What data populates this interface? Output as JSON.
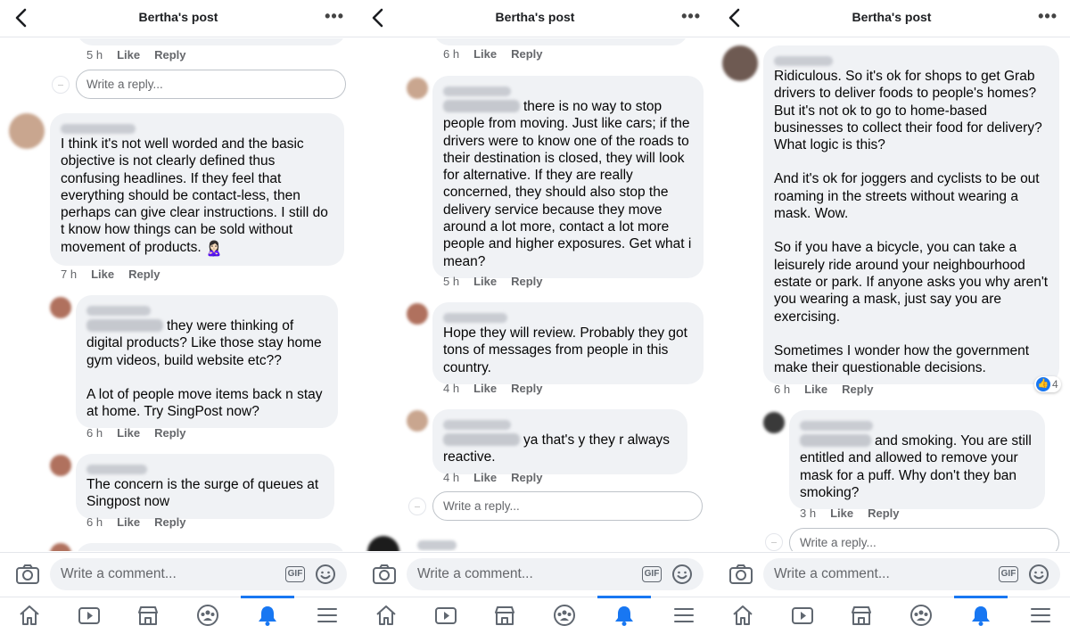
{
  "header_title": "Bertha's post",
  "more_label": "•••",
  "composer_placeholder": "Write a comment...",
  "gif_label": "GIF",
  "reply_placeholder": "Write a reply...",
  "screen1": {
    "top_meta": {
      "time": "5 h",
      "like": "Like",
      "reply": "Reply"
    },
    "c1": {
      "text": "I think it's not well worded and the basic objective is not clearly defined thus confusing headlines. If they feel that everything should be contact-less, then perhaps can give clear instructions. I still do t know how things can be sold without movement of products.",
      "emoji": "🙎🏻‍♀️",
      "time": "7 h",
      "like": "Like",
      "reply": "Reply"
    },
    "c2": {
      "line1": "they were thinking of",
      "text": "digital products? Like those stay home gym videos, build website etc??",
      "text2": "A lot of people move items back n stay at home. Try SingPost now?",
      "time": "6 h",
      "like": "Like",
      "reply": "Reply"
    },
    "c3": {
      "text": "The concern is the surge of queues at Singpost now",
      "time": "6 h",
      "like": "Like",
      "reply": "Reply"
    }
  },
  "screen2": {
    "top_meta": {
      "time": "6 h",
      "like": "Like",
      "reply": "Reply"
    },
    "c1": {
      "line1": "there is no way to stop",
      "text": "people from moving. Just like cars; if the drivers were to know one of the roads to their destination is closed, they will look for alternative. If they are really concerned, they should also stop the delivery service because they move around a lot more, contact a lot more people and higher exposures. Get what i mean?",
      "time": "5 h",
      "like": "Like",
      "reply": "Reply"
    },
    "c2": {
      "text": "Hope they will review. Probably they got tons of messages from people in this country.",
      "time": "4 h",
      "like": "Like",
      "reply": "Reply"
    },
    "c3": {
      "line1": "ya that's y they r always",
      "text": "reactive.",
      "time": "4 h",
      "like": "Like",
      "reply": "Reply"
    }
  },
  "screen3": {
    "c1": {
      "p1": "Ridiculous. So it's ok for shops to get Grab drivers to deliver foods to people's homes? But it's not ok to go to home-based businesses to collect their food for delivery? What logic is this?",
      "p2": "And it's ok for joggers and cyclists to be out roaming in the streets without wearing a mask. Wow.",
      "p3": "So if you have a bicycle, you can take a leisurely ride around your neighbourhood estate or park. If anyone asks you why aren't you wearing a mask, just say you are exercising.",
      "p4": "Sometimes I wonder how the government make their questionable decisions.",
      "time": "6 h",
      "like": "Like",
      "reply": "Reply",
      "reactions": "4"
    },
    "c2": {
      "line1": "and smoking. You are still",
      "text": "entitled and allowed to remove your mask for a puff. Why don't they ban smoking?",
      "time": "3 h",
      "like": "Like",
      "reply": "Reply"
    }
  },
  "colors": {
    "accent": "#1877f2",
    "bubble": "#f0f2f5",
    "meta": "#65676b"
  },
  "icons": [
    "back-arrow-icon",
    "more-icon",
    "camera-icon",
    "gif-icon",
    "smiley-icon",
    "home-icon",
    "video-icon",
    "marketplace-icon",
    "groups-icon",
    "notifications-bell-icon",
    "menu-icon",
    "like-reaction-icon"
  ]
}
